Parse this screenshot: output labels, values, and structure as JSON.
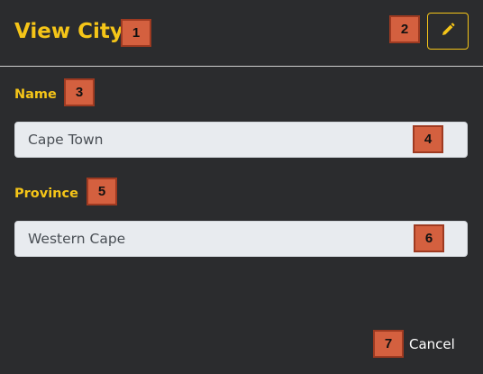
{
  "dialog": {
    "title": "View City",
    "edit_button_icon": "pencil-icon",
    "cancel_label": "Cancel"
  },
  "fields": {
    "name": {
      "label": "Name",
      "value": "Cape Town"
    },
    "province": {
      "label": "Province",
      "value": "Western Cape"
    }
  },
  "annotations": [
    "1",
    "2",
    "3",
    "4",
    "5",
    "6",
    "7"
  ],
  "colors": {
    "background": "#2b2c2e",
    "accent": "#f5c518",
    "field_bg": "#e8ebef",
    "badge": "#d4603f"
  }
}
